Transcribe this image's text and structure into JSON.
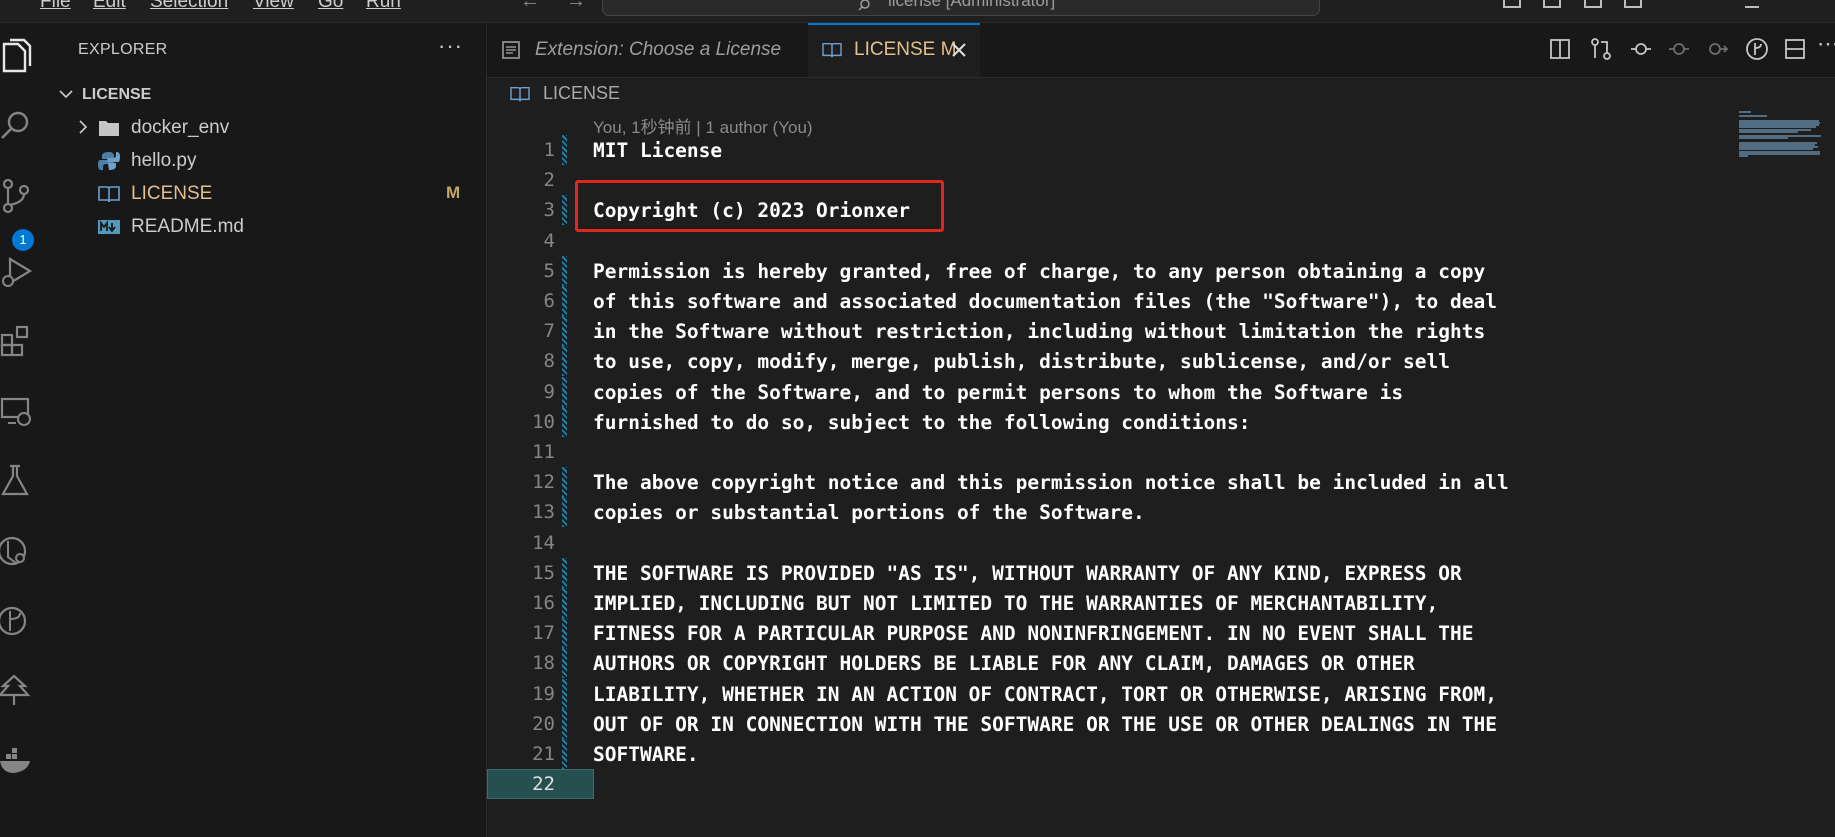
{
  "menu": {
    "items": [
      "File",
      "Edit",
      "Selection",
      "View",
      "Go",
      "Run"
    ]
  },
  "command_center": {
    "text": "license [Administrator]"
  },
  "activity_bar": {
    "icons": [
      "explorer-icon",
      "search-icon",
      "source-control-icon",
      "run-debug-icon",
      "extensions-icon",
      "remote-explorer-icon",
      "testing-icon",
      "git-graph-icon",
      "git-branch-icon",
      "tree-icon",
      "docker-icon"
    ],
    "source_control_badge": "1"
  },
  "sidebar": {
    "title": "EXPLORER",
    "more": "···",
    "section_label": "LICENSE",
    "files": [
      {
        "name": "docker_env",
        "type": "folder",
        "status": ""
      },
      {
        "name": "hello.py",
        "type": "python",
        "status": ""
      },
      {
        "name": "LICENSE",
        "type": "license",
        "status": "M"
      },
      {
        "name": "README.md",
        "type": "markdown",
        "status": ""
      }
    ]
  },
  "tabs": {
    "inactive_label": "Extension: Choose a License",
    "active_label": "LICENSE M"
  },
  "breadcrumb": {
    "label": "LICENSE"
  },
  "editor": {
    "codelens": "You, 1秒钟前 | 1 author (You)",
    "current_line": "22",
    "lines": [
      {
        "n": "1",
        "text": "MIT License"
      },
      {
        "n": "2",
        "text": ""
      },
      {
        "n": "3",
        "text": "Copyright (c) 2023 Orionxer"
      },
      {
        "n": "4",
        "text": ""
      },
      {
        "n": "5",
        "text": "Permission is hereby granted, free of charge, to any person obtaining a copy"
      },
      {
        "n": "6",
        "text": "of this software and associated documentation files (the \"Software\"), to deal"
      },
      {
        "n": "7",
        "text": "in the Software without restriction, including without limitation the rights"
      },
      {
        "n": "8",
        "text": "to use, copy, modify, merge, publish, distribute, sublicense, and/or sell"
      },
      {
        "n": "9",
        "text": "copies of the Software, and to permit persons to whom the Software is"
      },
      {
        "n": "10",
        "text": "furnished to do so, subject to the following conditions:"
      },
      {
        "n": "11",
        "text": ""
      },
      {
        "n": "12",
        "text": "The above copyright notice and this permission notice shall be included in all"
      },
      {
        "n": "13",
        "text": "copies or substantial portions of the Software."
      },
      {
        "n": "14",
        "text": ""
      },
      {
        "n": "15",
        "text": "THE SOFTWARE IS PROVIDED \"AS IS\", WITHOUT WARRANTY OF ANY KIND, EXPRESS OR"
      },
      {
        "n": "16",
        "text": "IMPLIED, INCLUDING BUT NOT LIMITED TO THE WARRANTIES OF MERCHANTABILITY,"
      },
      {
        "n": "17",
        "text": "FITNESS FOR A PARTICULAR PURPOSE AND NONINFRINGEMENT. IN NO EVENT SHALL THE"
      },
      {
        "n": "18",
        "text": "AUTHORS OR COPYRIGHT HOLDERS BE LIABLE FOR ANY CLAIM, DAMAGES OR OTHER"
      },
      {
        "n": "19",
        "text": "LIABILITY, WHETHER IN AN ACTION OF CONTRACT, TORT OR OTHERWISE, ARISING FROM,"
      },
      {
        "n": "20",
        "text": "OUT OF OR IN CONNECTION WITH THE SOFTWARE OR THE USE OR OTHER DEALINGS IN THE"
      },
      {
        "n": "21",
        "text": "SOFTWARE."
      },
      {
        "n": "22",
        "text": ""
      }
    ]
  },
  "colors": {
    "accent": "#0078d4",
    "modified": "#e2c08d",
    "highlight_box": "#e0281f"
  }
}
